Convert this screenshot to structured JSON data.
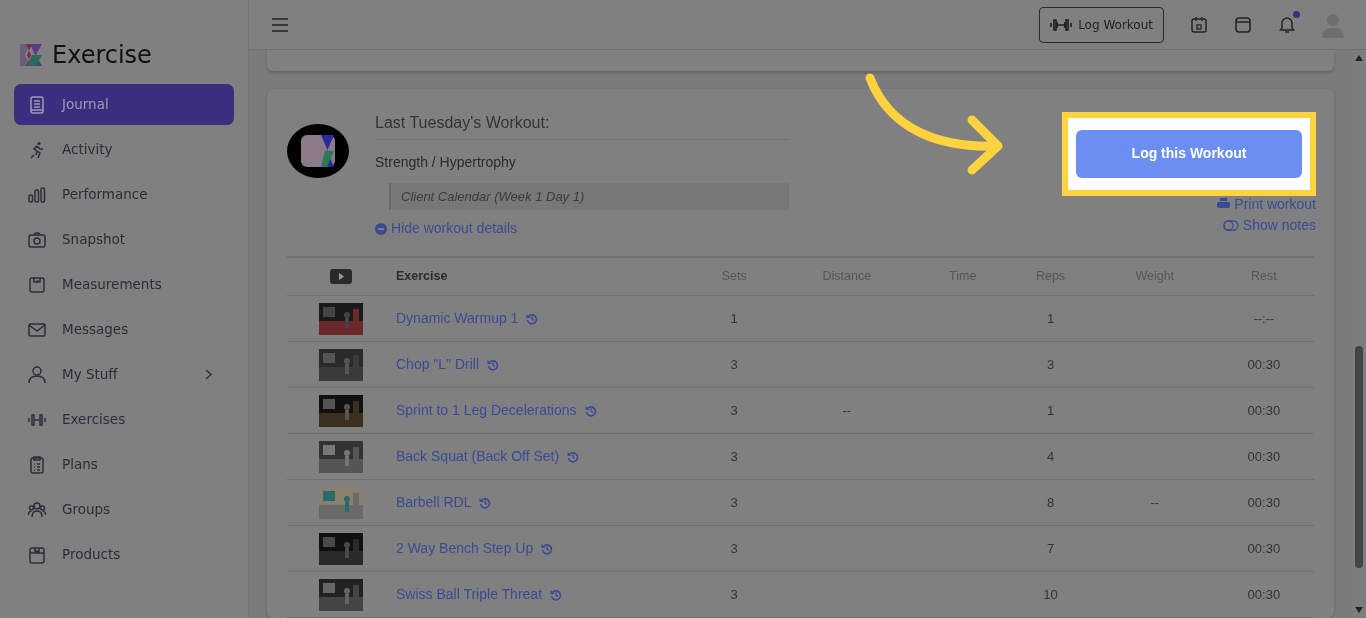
{
  "brand": {
    "name": "Exercise"
  },
  "sidebar": {
    "items": [
      {
        "label": "Journal",
        "selected": true,
        "has_submenu": false
      },
      {
        "label": "Activity",
        "selected": false,
        "has_submenu": false
      },
      {
        "label": "Performance",
        "selected": false,
        "has_submenu": false
      },
      {
        "label": "Snapshot",
        "selected": false,
        "has_submenu": false
      },
      {
        "label": "Measurements",
        "selected": false,
        "has_submenu": false
      },
      {
        "label": "Messages",
        "selected": false,
        "has_submenu": false
      },
      {
        "label": "My Stuff",
        "selected": false,
        "has_submenu": true
      },
      {
        "label": "Exercises",
        "selected": false,
        "has_submenu": false
      },
      {
        "label": "Plans",
        "selected": false,
        "has_submenu": false
      },
      {
        "label": "Groups",
        "selected": false,
        "has_submenu": false
      },
      {
        "label": "Products",
        "selected": false,
        "has_submenu": false
      }
    ]
  },
  "header": {
    "log_button": "Log Workout",
    "notifications_unread": true
  },
  "workout": {
    "title": "Last Tuesday's Workout:",
    "type": "Strength / Hypertrophy",
    "program": "Client Calendar (Week 1 Day 1)",
    "toggle_link": "Hide workout details",
    "log_button": "Log this Workout",
    "print_link": "Print workout",
    "notes_link": "Show notes"
  },
  "table": {
    "columns": [
      "Exercise",
      "Sets",
      "Distance",
      "Time",
      "Reps",
      "Weight",
      "Rest"
    ],
    "rows": [
      {
        "exercise": "Dynamic Warmup 1",
        "sets": "1",
        "distance": "",
        "time": "",
        "reps": "1",
        "weight": "",
        "rest": "--:--"
      },
      {
        "exercise": "Chop \"L\" Drill",
        "sets": "3",
        "distance": "",
        "time": "",
        "reps": "3",
        "weight": "",
        "rest": "00:30"
      },
      {
        "exercise": "Sprint to 1 Leg Decelerations",
        "sets": "3",
        "distance": "--",
        "time": "",
        "reps": "1",
        "weight": "",
        "rest": "00:30"
      },
      {
        "exercise": "Back Squat (Back Off Set)",
        "sets": "3",
        "distance": "",
        "time": "",
        "reps": "4",
        "weight": "",
        "rest": "00:30"
      },
      {
        "exercise": "Barbell RDL",
        "sets": "3",
        "distance": "",
        "time": "",
        "reps": "8",
        "weight": "--",
        "rest": "00:30"
      },
      {
        "exercise": "2 Way Bench Step Up",
        "sets": "3",
        "distance": "",
        "time": "",
        "reps": "7",
        "weight": "",
        "rest": "00:30"
      },
      {
        "exercise": "Swiss Ball Triple Threat",
        "sets": "3",
        "distance": "",
        "time": "",
        "reps": "10",
        "weight": "",
        "rest": "00:30"
      }
    ]
  }
}
